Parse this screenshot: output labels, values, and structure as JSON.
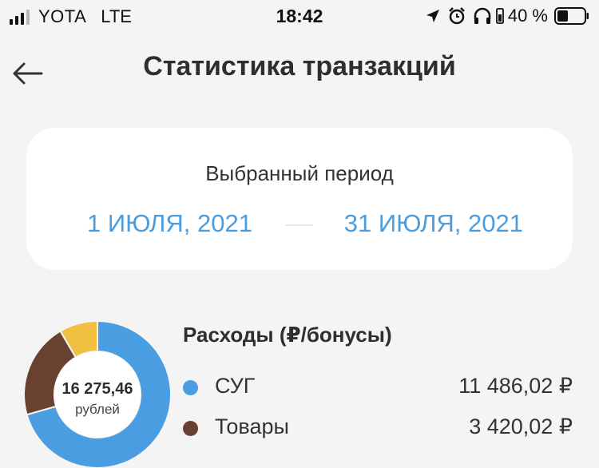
{
  "status_bar": {
    "carrier": "YOTA",
    "network": "LTE",
    "time": "18:42",
    "battery_percent": "40 %",
    "icons": [
      "location-icon",
      "alarm-icon",
      "headphones-icon",
      "battery-icon"
    ]
  },
  "header": {
    "title": "Статистика транзакций",
    "back_icon": "arrow-left-icon"
  },
  "period": {
    "label": "Выбранный период",
    "from": "1 ИЮЛЯ, 2021",
    "to": "31 ИЮЛЯ, 2021"
  },
  "expenses": {
    "title": "Расходы (₽/бонусы)",
    "total_value": "16 275,46",
    "total_unit": "рублей",
    "items": [
      {
        "label": "СУГ",
        "amount": "11 486,02 ₽",
        "color": "#4a9de0"
      },
      {
        "label": "Товары",
        "amount": "3 420,02 ₽",
        "color": "#6a4030"
      }
    ]
  },
  "chart_data": {
    "type": "pie",
    "values": [
      11486.02,
      3420.02,
      1369.42
    ],
    "labels": [
      "СУГ",
      "Товары",
      ""
    ],
    "colors": [
      "#4a9de0",
      "#6a4030",
      "#f0c040"
    ]
  },
  "colors": {
    "accent": "#4a9de0",
    "background": "#f4f4f4",
    "card": "#ffffff"
  }
}
